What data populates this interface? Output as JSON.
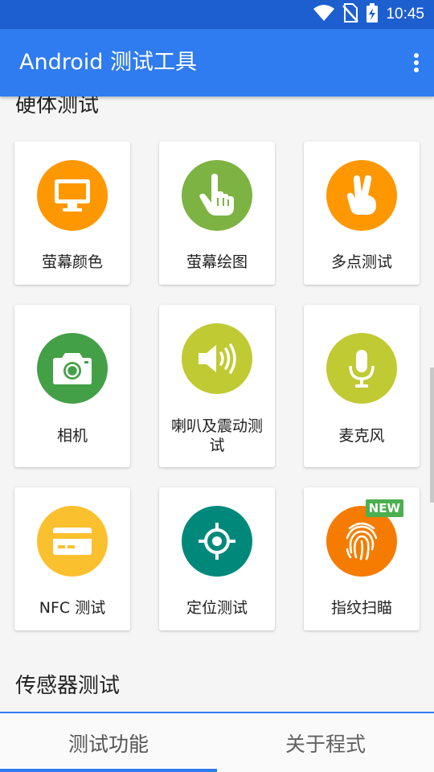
{
  "status_bar": {
    "time": "10:45",
    "icons": [
      "wifi-icon",
      "no-sim-icon",
      "battery-charging-icon"
    ]
  },
  "app_bar": {
    "title": "Android 测试工具",
    "menu_icon": "more-vert-icon"
  },
  "sections": {
    "hardware_title": "硬体测试",
    "sensor_title": "传感器测试"
  },
  "cards": [
    {
      "label": "萤幕颜色",
      "icon": "monitor-icon",
      "color": "#ff9800"
    },
    {
      "label": "萤幕绘图",
      "icon": "touch-hand-icon",
      "color": "#7cb342"
    },
    {
      "label": "多点测试",
      "icon": "two-finger-icon",
      "color": "#ff9800"
    },
    {
      "label": "相机",
      "icon": "camera-icon",
      "color": "#43a047"
    },
    {
      "label": "喇叭及震动测试",
      "icon": "speaker-icon",
      "color": "#c0ca33"
    },
    {
      "label": "麦克风",
      "icon": "microphone-icon",
      "color": "#c0ca33"
    },
    {
      "label": "NFC 测试",
      "icon": "card-icon",
      "color": "#fbc02d"
    },
    {
      "label": "定位测试",
      "icon": "gps-target-icon",
      "color": "#00897b"
    },
    {
      "label": "指纹扫瞄",
      "icon": "fingerprint-icon",
      "color": "#f57c00",
      "badge": "NEW"
    }
  ],
  "tabs": [
    {
      "label": "测试功能",
      "active": true
    },
    {
      "label": "关于程式",
      "active": false
    }
  ],
  "colors": {
    "primary": "#2f7bf0",
    "primary_dark": "#1e5fd0",
    "badge": "#4caf50"
  }
}
